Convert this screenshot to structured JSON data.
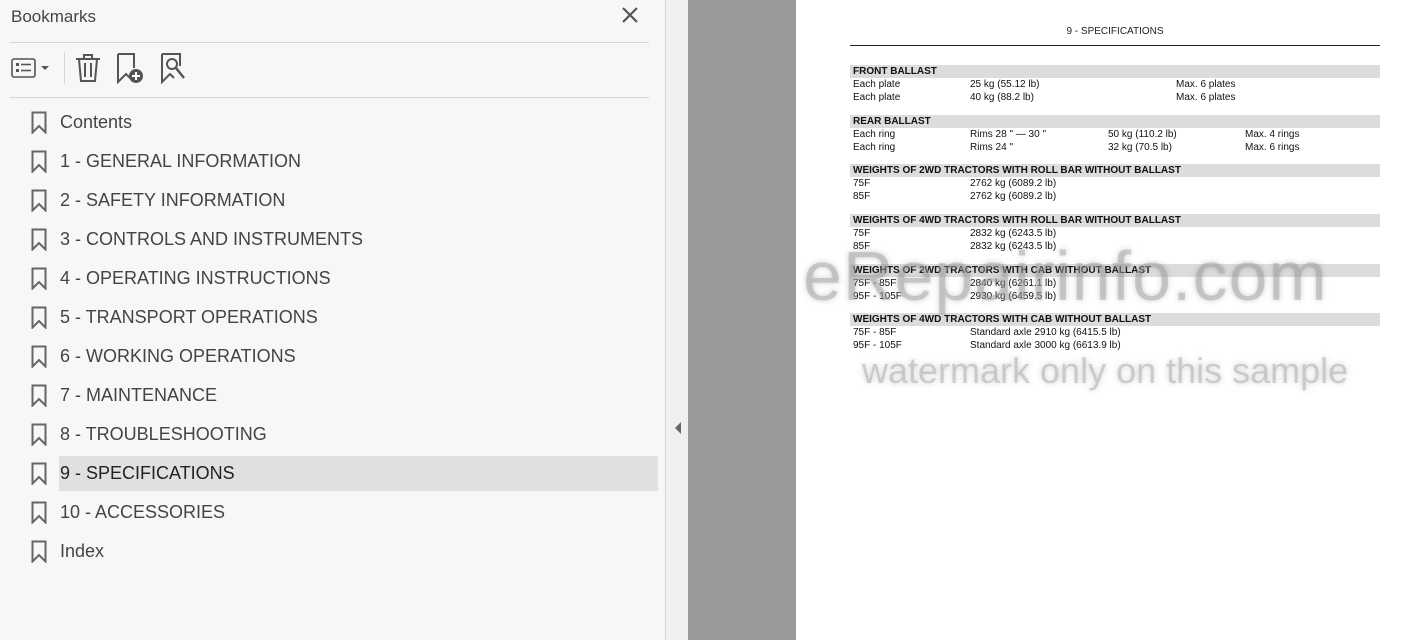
{
  "panel": {
    "title": "Bookmarks",
    "toolbar": {
      "options_icon": "list-options-icon",
      "delete_icon": "trash-icon",
      "new_bookmark_icon": "new-bookmark-icon",
      "find_bookmark_icon": "find-current-bookmark-icon"
    },
    "items": [
      {
        "label": "Contents"
      },
      {
        "label": "1 - GENERAL INFORMATION"
      },
      {
        "label": "2 - SAFETY INFORMATION"
      },
      {
        "label": "3 - CONTROLS AND INSTRUMENTS"
      },
      {
        "label": "4 - OPERATING INSTRUCTIONS"
      },
      {
        "label": "5 - TRANSPORT OPERATIONS"
      },
      {
        "label": "6 - WORKING OPERATIONS"
      },
      {
        "label": "7 - MAINTENANCE"
      },
      {
        "label": "8 - TROUBLESHOOTING"
      },
      {
        "label": "9 - SPECIFICATIONS"
      },
      {
        "label": "10 - ACCESSORIES"
      },
      {
        "label": "Index"
      }
    ],
    "selected_index": 9
  },
  "document": {
    "header": "9 - SPECIFICATIONS",
    "sections": {
      "front": {
        "title": "FRONT BALLAST",
        "rows": [
          {
            "c1": "Each plate",
            "c2": "25 kg (55.12 lb)",
            "c3": "Max.  6 plates"
          },
          {
            "c1": "Each plate",
            "c2": "40 kg (88.2 lb)",
            "c3": "Max.  6 plates"
          }
        ]
      },
      "rear": {
        "title": "REAR BALLAST",
        "rows": [
          {
            "c1": "Each ring",
            "c2": "Rims 28 \" — 30 \"",
            "c3": "50 kg (110.2 lb)",
            "c4": "Max.  4 rings"
          },
          {
            "c1": "Each ring",
            "c2": "Rims 24 \"",
            "c3": "32 kg (70.5 lb)",
            "c4": "Max.  6 rings"
          }
        ]
      },
      "w2wd_rollbar": {
        "title": "WEIGHTS OF 2WD TRACTORS WITH ROLL BAR WITHOUT BALLAST",
        "rows": [
          {
            "c1": "75F",
            "c2": "2762 kg (6089.2 lb)"
          },
          {
            "c1": "85F",
            "c2": "2762 kg (6089.2 lb)"
          }
        ]
      },
      "w4wd_rollbar": {
        "title": "WEIGHTS OF 4WD TRACTORS WITH ROLL BAR WITHOUT BALLAST",
        "rows": [
          {
            "c1": "75F",
            "c2": "2832 kg (6243.5 lb)"
          },
          {
            "c1": "85F",
            "c2": "2832 kg (6243.5 lb)"
          }
        ]
      },
      "w2wd_cab": {
        "title": "WEIGHTS OF 2WD TRACTORS WITH CAB WITHOUT BALLAST",
        "rows": [
          {
            "c1": "75F - 85F",
            "c2": "2840 kg (6261.1 lb)"
          },
          {
            "c1": "95F - 105F",
            "c2": "2930 kg (6459.5 lb)"
          }
        ]
      },
      "w4wd_cab": {
        "title": "WEIGHTS OF 4WD TRACTORS WITH CAB WITHOUT BALLAST",
        "rows": [
          {
            "c1": "75F - 85F",
            "c2": "Standard axle 2910 kg (6415.5 lb)"
          },
          {
            "c1": "95F - 105F",
            "c2": "Standard axle 3000 kg (6613.9 lb)"
          }
        ]
      }
    },
    "watermark": {
      "line1": "eRepairinfo.com",
      "line2": "watermark only on this sample"
    }
  }
}
